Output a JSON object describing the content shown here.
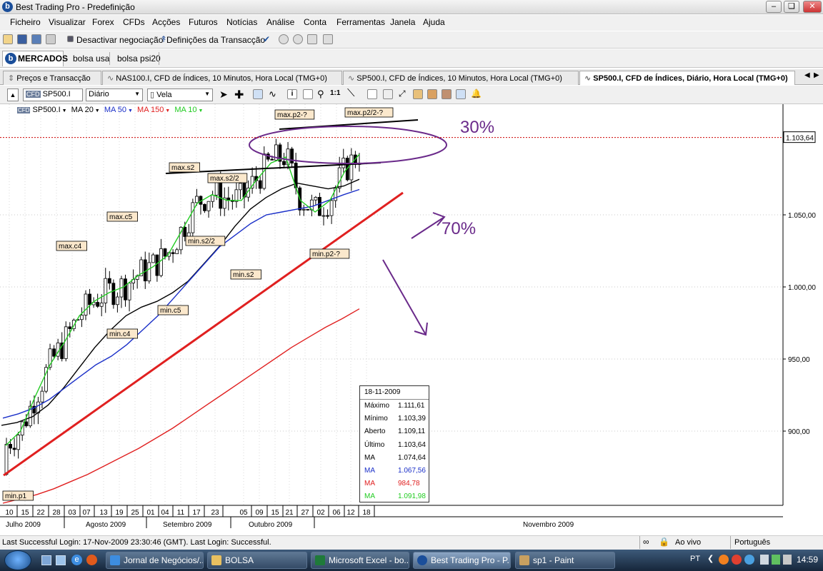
{
  "window": {
    "title": "Best Trading Pro - Predefinição"
  },
  "menu": [
    "Ficheiro",
    "Visualizar",
    "Forex",
    "CFDs",
    "Acções",
    "Futuros",
    "Notícias",
    "Análise",
    "Conta",
    "Ferramentas",
    "Janela",
    "Ajuda"
  ],
  "toolbar": {
    "deactivate": "Desactivar negociação",
    "transaction_settings": "Definições da Transacção"
  },
  "market_tabs": [
    "MERCADOS",
    "bolsa usa",
    "bolsa psi20"
  ],
  "doc_tabs": [
    "Preços e Transacção",
    "NAS100.I, CFD de Índices, 10 Minutos, Hora Local (TMG+0)",
    "SP500.I, CFD de Índices, 10 Minutos, Hora Local (TMG+0)",
    "SP500.I, CFD de Índices, Diário, Hora Local (TMG+0)"
  ],
  "chart_toolbar": {
    "symbol": "SP500.I",
    "period": "Diário",
    "chart_type": "Vela"
  },
  "legend": [
    {
      "label": "SP500.I",
      "color": "#000000"
    },
    {
      "label": "MA 20",
      "color": "#000000"
    },
    {
      "label": "MA 50",
      "color": "#1a2fc8"
    },
    {
      "label": "MA 150",
      "color": "#e02020"
    },
    {
      "label": "MA 10",
      "color": "#22cc22"
    }
  ],
  "chart_data": {
    "type": "line",
    "y_axis": {
      "ticks": [
        1050,
        1000,
        950,
        900
      ],
      "tick_labels": [
        "1.050,00",
        "1.000,00",
        "950,00",
        "900,00"
      ],
      "current_price_label": "1.103,64",
      "current_price": 1103.64
    },
    "x_ticks": [
      "10",
      "15",
      "22",
      "28",
      "03",
      "07",
      "13",
      "19",
      "25",
      "01",
      "04",
      "11",
      "17",
      "23",
      "05",
      "09",
      "15",
      "21",
      "27",
      "02",
      "06",
      "12",
      "18"
    ],
    "month_labels": [
      "Julho 2009",
      "Agosto 2009",
      "Setembro 2009",
      "Outubro 2009",
      "Novembro 2009"
    ],
    "series": [
      {
        "name": "MA 20",
        "color": "#000000",
        "values": [
          904,
          906,
          910,
          918,
          930,
          944,
          958,
          970,
          980,
          986,
          990,
          996,
          1004,
          1016,
          1028,
          1042,
          1054,
          1062,
          1068,
          1072,
          1070,
          1068,
          1070,
          1074.64
        ]
      },
      {
        "name": "MA 50",
        "color": "#1a2fc8",
        "values": [
          909,
          912,
          916,
          922,
          930,
          938,
          946,
          952,
          960,
          970,
          980,
          992,
          1004,
          1016,
          1028,
          1036,
          1044,
          1050,
          1052,
          1054,
          1056,
          1060,
          1064,
          1067.56
        ]
      },
      {
        "name": "MA 150",
        "color": "#e02020",
        "values": [
          850,
          853,
          856,
          860,
          865,
          870,
          876,
          882,
          888,
          895,
          902,
          910,
          918,
          926,
          934,
          942,
          950,
          958,
          965,
          972,
          978,
          984.78
        ]
      },
      {
        "name": "MA 10",
        "color": "#22cc22",
        "values": [
          890,
          900,
          924,
          946,
          962,
          980,
          990,
          996,
          1000,
          1008,
          1014,
          1022,
          1040,
          1058,
          1064,
          1060,
          1060,
          1074,
          1086,
          1090,
          1060,
          1052,
          1060,
          1080,
          1091.98
        ]
      }
    ],
    "annotations": [
      "max.p2-?",
      "max.p2/2-?",
      "max.s2",
      "max.s2/2",
      "max.c5",
      "max.c4",
      "min.s2/2",
      "min.s2",
      "min.c5",
      "min.c4",
      "min.p2-?",
      "min.p1",
      "30%",
      "70%"
    ]
  },
  "tooltip": {
    "date": "18-11-2009",
    "rows": [
      {
        "label": "Máximo",
        "value": "1.111,61",
        "color": "#000000"
      },
      {
        "label": "Mínimo",
        "value": "1.103,39",
        "color": "#000000"
      },
      {
        "label": "Aberto",
        "value": "1.109,11",
        "color": "#000000"
      },
      {
        "label": "Último",
        "value": "1.103,64",
        "color": "#000000"
      },
      {
        "label": "MA",
        "value": "1.074,64",
        "color": "#000000"
      },
      {
        "label": "MA",
        "value": "1.067,56",
        "color": "#1a2fc8"
      },
      {
        "label": "MA",
        "value": "984,78",
        "color": "#e02020"
      },
      {
        "label": "MA",
        "value": "1.091,98",
        "color": "#22cc22"
      }
    ]
  },
  "status": {
    "login": "Last Successful Login: 17-Nov-2009 23:30:46 (GMT). Last Login: Successful.",
    "live": "Ao vivo",
    "language": "Português"
  },
  "taskbar": {
    "items": [
      "Jornal de Negócios/...",
      "BOLSA",
      "Microsoft Excel - bo...",
      "Best Trading Pro - P...",
      "sp1 - Paint"
    ],
    "lang": "PT",
    "clock": "14:59"
  }
}
